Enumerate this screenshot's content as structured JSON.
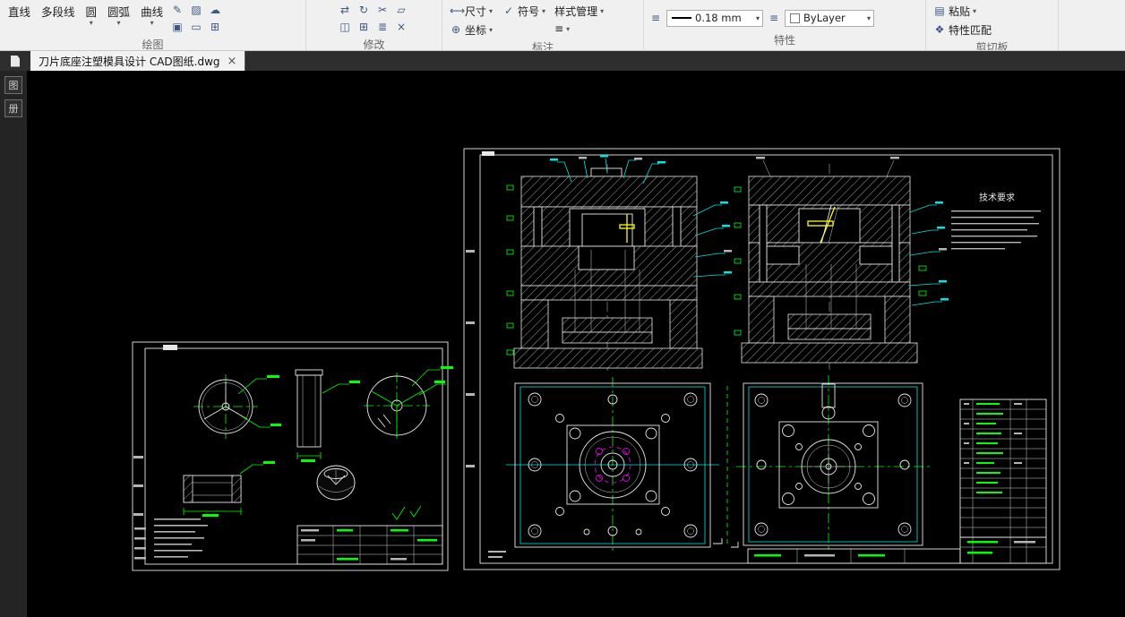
{
  "ribbon": {
    "draw": {
      "label": "绘图",
      "tools": [
        {
          "label": "直线"
        },
        {
          "label": "多段线"
        },
        {
          "label": "圆"
        },
        {
          "label": "圆弧"
        },
        {
          "label": "曲线"
        }
      ]
    },
    "modify": {
      "label": "修改"
    },
    "annotate": {
      "label": "标注",
      "dim": "尺寸",
      "symbol": "符号",
      "coord": "坐标",
      "style_mgr": "样式管理"
    },
    "properties": {
      "label": "特性",
      "lineweight": "0.18 mm",
      "color_value": "ByLayer"
    },
    "clipboard": {
      "label": "剪切板",
      "paste": "粘贴",
      "match": "特性匹配"
    }
  },
  "tabbar": {
    "active_tab": "刀片底座注塑模具设计 CAD图纸.dwg",
    "close_glyph": "×"
  },
  "sidebar": {
    "panel_icon_1": "图",
    "panel_icon_2": "册"
  },
  "drawing": {
    "tech_requirements_title": "技术要求"
  },
  "icons": {
    "line": "╱",
    "polyline": "∠",
    "circle": "○",
    "arc": "◠",
    "spline": "∿",
    "dropdown": "▾",
    "pencil": "✎",
    "hatch": "▨",
    "cloud": "☁",
    "region": "▣",
    "rect": "▭",
    "grid": "⊞",
    "modify": [
      "⇄",
      "↻",
      "✂",
      "▱",
      "◫",
      "⊞",
      "≣",
      "×"
    ],
    "dim": "⟷",
    "symbol": "✓",
    "coord": "⊕",
    "menu": "≡",
    "paste": "▤",
    "match": "❖"
  }
}
